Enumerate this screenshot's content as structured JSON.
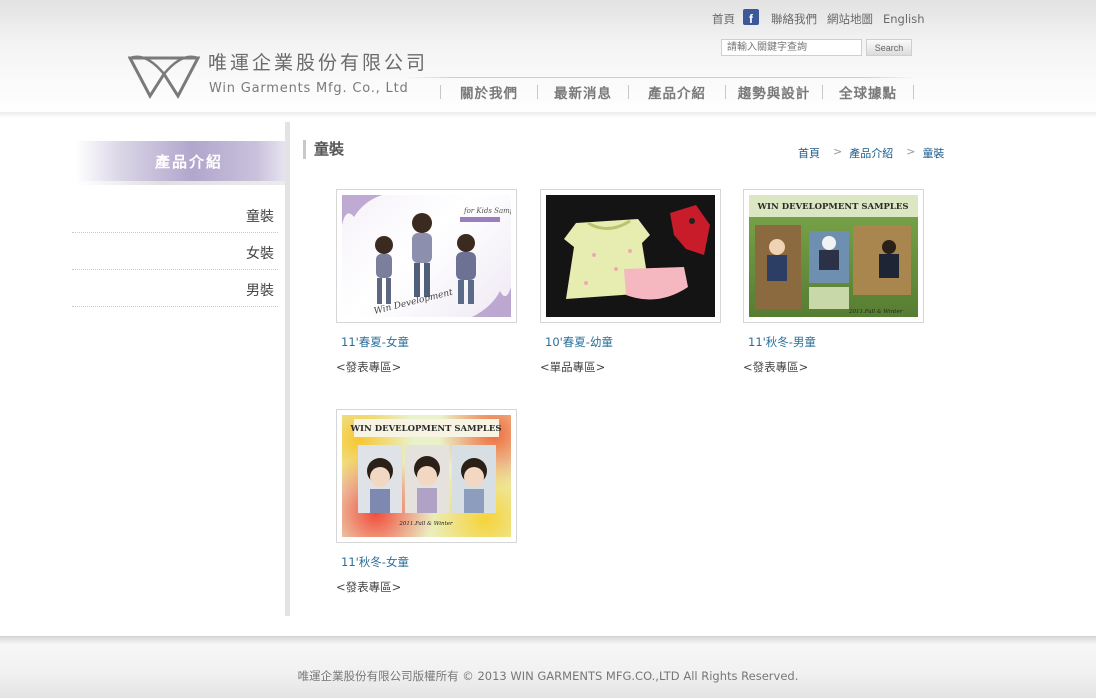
{
  "brand": {
    "name_cn": "唯運企業股份有限公司",
    "name_en": "Win Garments Mfg. Co., Ltd"
  },
  "toplinks": {
    "home": "首頁",
    "contact": "聯絡我們",
    "sitemap": "網站地圖",
    "english": "English"
  },
  "search": {
    "placeholder": "請輸入關鍵字查詢",
    "button": "Search"
  },
  "nav": [
    {
      "label": "關於我們"
    },
    {
      "label": "最新消息"
    },
    {
      "label": "產品介紹"
    },
    {
      "label": "趨勢與設計"
    },
    {
      "label": "全球據點"
    }
  ],
  "sidebar": {
    "title": "產品介紹",
    "items": [
      {
        "label": "童裝"
      },
      {
        "label": "女裝"
      },
      {
        "label": "男裝"
      }
    ]
  },
  "page": {
    "title": "童裝",
    "breadcrumb": [
      "首頁",
      "產品介紹",
      "童裝"
    ],
    "breadcrumb_sep": ">"
  },
  "products": [
    {
      "title": "11'春夏-女童",
      "tag": "<發表專區>"
    },
    {
      "title": "10'春夏-幼童",
      "tag": "<單品專區>"
    },
    {
      "title": "11'秋冬-男童",
      "tag": "<發表專區>"
    },
    {
      "title": "11'秋冬-女童",
      "tag": "<發表專區>"
    }
  ],
  "thumb_text": {
    "kids_sample": "for Kids Sample",
    "win_dev": "Win Development",
    "samples_banner": "WIN DEVELOPMENT SAMPLES",
    "season": "2011.Fall & Winter"
  },
  "footer": {
    "copyright": "唯運企業股份有限公司版權所有 © 2013 WIN GARMENTS MFG.CO.,LTD All Rights Reserved."
  },
  "colors": {
    "accent_purple": "#b1a6cc",
    "link_blue": "#2a6f9a",
    "facebook": "#3b5998"
  }
}
